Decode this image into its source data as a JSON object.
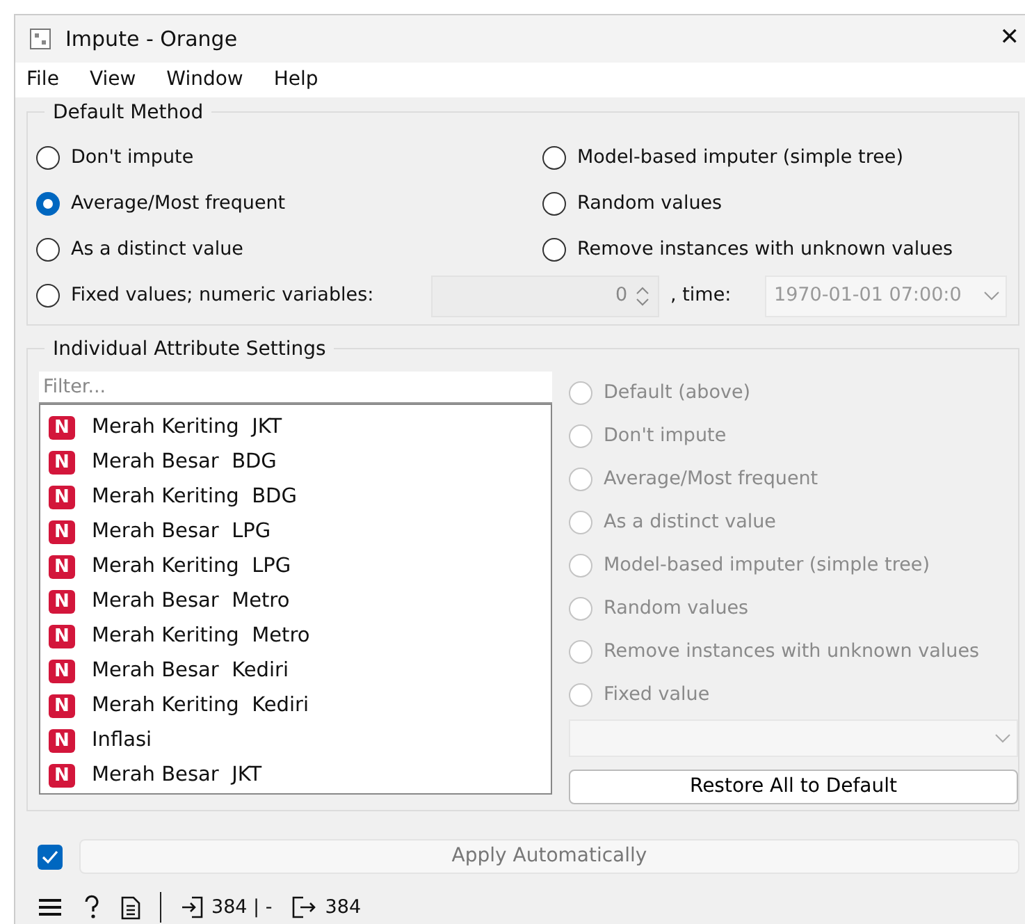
{
  "window": {
    "title": "Impute - Orange",
    "close": "✕"
  },
  "menu": [
    "File",
    "View",
    "Window",
    "Help"
  ],
  "default_method": {
    "title": "Default Method",
    "options": [
      {
        "label": "Don't impute",
        "selected": false
      },
      {
        "label": "Model-based imputer (simple tree)",
        "selected": false
      },
      {
        "label": "Average/Most frequent",
        "selected": true
      },
      {
        "label": "Random values",
        "selected": false
      },
      {
        "label": "As a distinct value",
        "selected": false
      },
      {
        "label": "Remove instances with unknown values",
        "selected": false
      }
    ],
    "fixed": {
      "label": "Fixed values; numeric variables:",
      "selected": false,
      "numeric_value": "0",
      "time_label": ", time:",
      "time_value": "1970-01-01 07:00:0"
    }
  },
  "individual": {
    "title": "Individual Attribute Settings",
    "filter": {
      "placeholder": "Filter..."
    },
    "variables": [
      {
        "type": "N",
        "name": "Merah Keriting  JKT"
      },
      {
        "type": "N",
        "name": "Merah Besar  BDG"
      },
      {
        "type": "N",
        "name": "Merah Keriting  BDG"
      },
      {
        "type": "N",
        "name": "Merah Besar  LPG"
      },
      {
        "type": "N",
        "name": "Merah Keriting  LPG"
      },
      {
        "type": "N",
        "name": "Merah Besar  Metro"
      },
      {
        "type": "N",
        "name": "Merah Keriting  Metro"
      },
      {
        "type": "N",
        "name": "Merah Besar  Kediri"
      },
      {
        "type": "N",
        "name": "Merah Keriting  Kediri"
      },
      {
        "type": "N",
        "name": "Inflasi"
      },
      {
        "type": "N",
        "name": "Merah Besar  JKT"
      }
    ],
    "methods": [
      {
        "label": "Default (above)",
        "selected": false,
        "disabled": true
      },
      {
        "label": "Don't impute",
        "selected": false,
        "disabled": true
      },
      {
        "label": "Average/Most frequent",
        "selected": false,
        "disabled": true
      },
      {
        "label": "As a distinct value",
        "selected": false,
        "disabled": true
      },
      {
        "label": "Model-based imputer (simple tree)",
        "selected": false,
        "disabled": true
      },
      {
        "label": "Random values",
        "selected": false,
        "disabled": true
      },
      {
        "label": "Remove instances with unknown values",
        "selected": false,
        "disabled": true
      },
      {
        "label": "Fixed value",
        "selected": false,
        "disabled": true
      }
    ],
    "restore_button": "Restore All to Default"
  },
  "apply": {
    "checked": true,
    "label": "Apply Automatically",
    "disabled": true
  },
  "status_bar": {
    "input_count": "384 | -",
    "output_count": "384"
  }
}
